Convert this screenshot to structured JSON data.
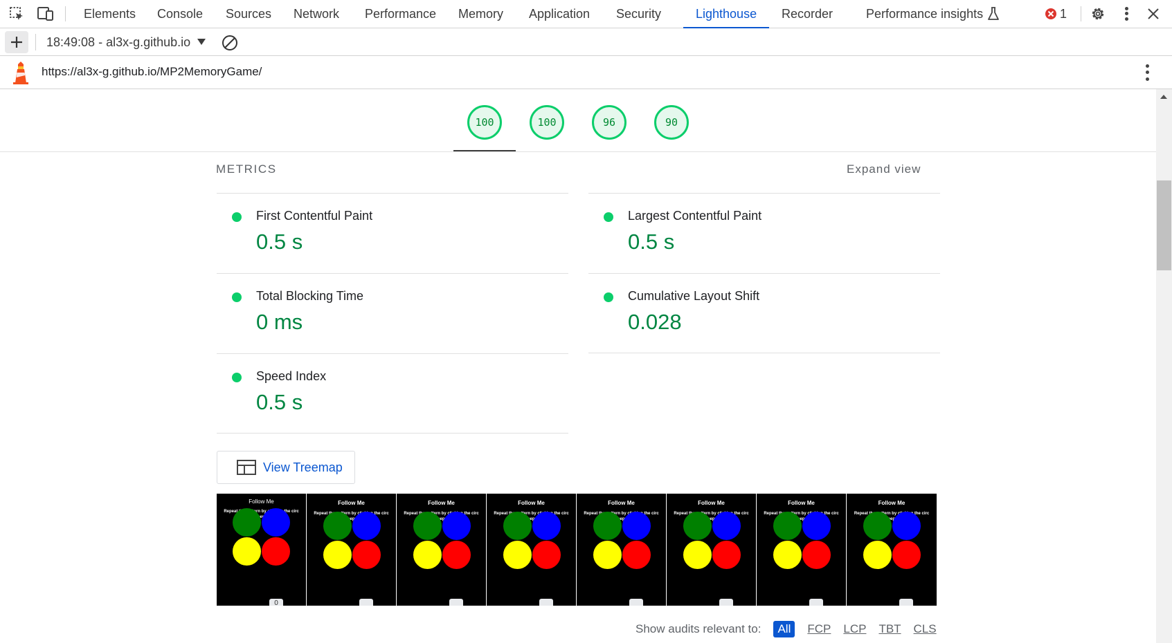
{
  "devtools": {
    "tabs": [
      "Elements",
      "Console",
      "Sources",
      "Network",
      "Performance",
      "Memory",
      "Application",
      "Security",
      "Lighthouse",
      "Recorder",
      "Performance insights"
    ],
    "active_tab": "Lighthouse",
    "error_count": "1"
  },
  "toolbar": {
    "report_selector": "18:49:08 - al3x-g.github.io"
  },
  "report": {
    "url": "https://al3x-g.github.io/MP2MemoryGame/"
  },
  "gauges": [
    {
      "score": "100"
    },
    {
      "score": "100"
    },
    {
      "score": "96"
    },
    {
      "score": "90"
    }
  ],
  "metrics": {
    "title": "METRICS",
    "expand_label": "Expand view",
    "items": [
      {
        "label": "First Contentful Paint",
        "value": "0.5 s"
      },
      {
        "label": "Largest Contentful Paint",
        "value": "0.5 s"
      },
      {
        "label": "Total Blocking Time",
        "value": "0 ms"
      },
      {
        "label": "Cumulative Layout Shift",
        "value": "0.028"
      },
      {
        "label": "Speed Index",
        "value": "0.5 s"
      }
    ]
  },
  "treemap": {
    "label": "View Treemap"
  },
  "filmstrip": {
    "frame_title": "Follow Me",
    "frame_subtitle_1": "Repeat the pattern by clicking the circ",
    "frame_subtitle_2": "to keep up!",
    "first_frame_badge": "0",
    "circle_colors": [
      "#008000",
      "#0000ff",
      "#ffff00",
      "#ff0000"
    ]
  },
  "audit_filter": {
    "label": "Show audits relevant to:",
    "options": [
      "All",
      "FCP",
      "LCP",
      "TBT",
      "CLS"
    ],
    "active": "All"
  },
  "colors": {
    "accent": "#0b57d0",
    "pass_green": "#0cce6b",
    "pass_text": "#018642"
  }
}
